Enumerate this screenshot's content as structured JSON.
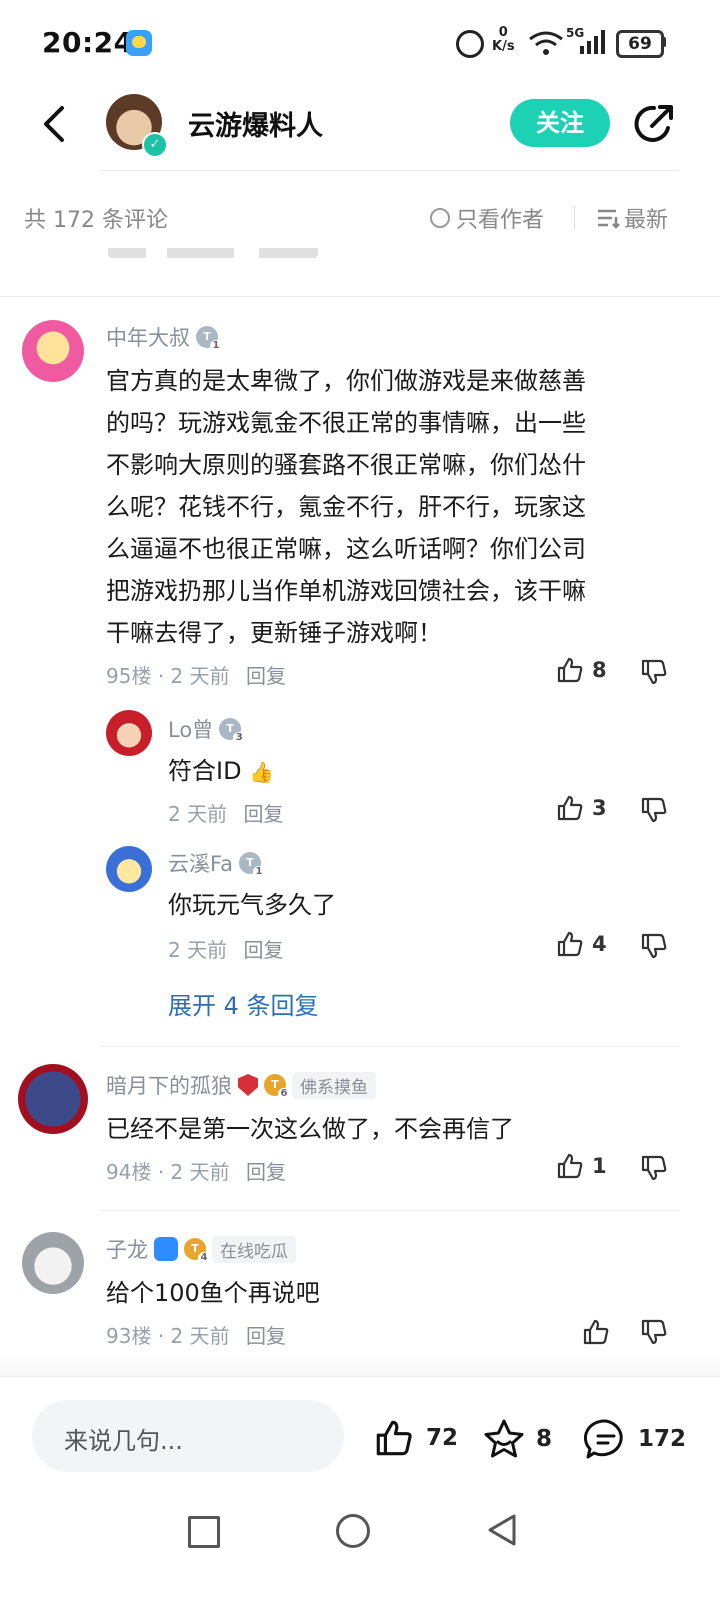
{
  "status": {
    "time": "20:24",
    "net_speed_value": "0",
    "net_speed_unit": "K/s",
    "network": "5G",
    "battery": "69"
  },
  "header": {
    "author": "云游爆料人",
    "follow_label": "关注"
  },
  "sort_bar": {
    "count_label": "共 172 条评论",
    "only_author": "只看作者",
    "latest": "最新"
  },
  "comments": [
    {
      "user": "中年大叔",
      "level": "1",
      "text_lines": [
        "官方真的是太卑微了，你们做游戏是来做慈善",
        "的吗？玩游戏氪金不很正常的事情嘛，出一些",
        "不影响大原则的骚套路不很正常嘛，你们怂什",
        "么呢？花钱不行，氪金不行，肝不行，玩家这",
        "么逼逼不也很正常嘛，这么听话啊？你们公司",
        "把游戏扔那儿当作单机游戏回馈社会，该干嘛",
        "干嘛去得了，更新锤子游戏啊！"
      ],
      "floor": "95楼",
      "time": "· 2 天前",
      "reply": "回复",
      "likes": "8",
      "replies": [
        {
          "user": "Lo曾",
          "level": "3",
          "text": "符合ID",
          "time": "2 天前",
          "reply": "回复",
          "likes": "3"
        },
        {
          "user": "云溪Fa",
          "level": "1",
          "text": "你玩元气多久了",
          "time": "2 天前",
          "reply": "回复",
          "likes": "4"
        }
      ],
      "expand": "展开 4 条回复"
    },
    {
      "user": "暗月下的孤狼",
      "level": "6",
      "tag": "佛系摸鱼",
      "text": "已经不是第一次这么做了，不会再信了",
      "floor": "94楼",
      "time": "· 2 天前",
      "reply": "回复",
      "likes": "1"
    },
    {
      "user": "子龙",
      "level": "4",
      "tag": "在线吃瓜",
      "text": "给个100鱼个再说吧",
      "floor": "93楼",
      "time": "· 2 天前",
      "reply": "回复",
      "likes": ""
    }
  ],
  "bottom_bar": {
    "input_placeholder": "来说几句...",
    "like_count": "72",
    "fav_count": "8",
    "comment_count": "172"
  },
  "colors": {
    "accent": "#1dd1b4",
    "link": "#2a6fb6",
    "muted": "#8a8f99"
  }
}
